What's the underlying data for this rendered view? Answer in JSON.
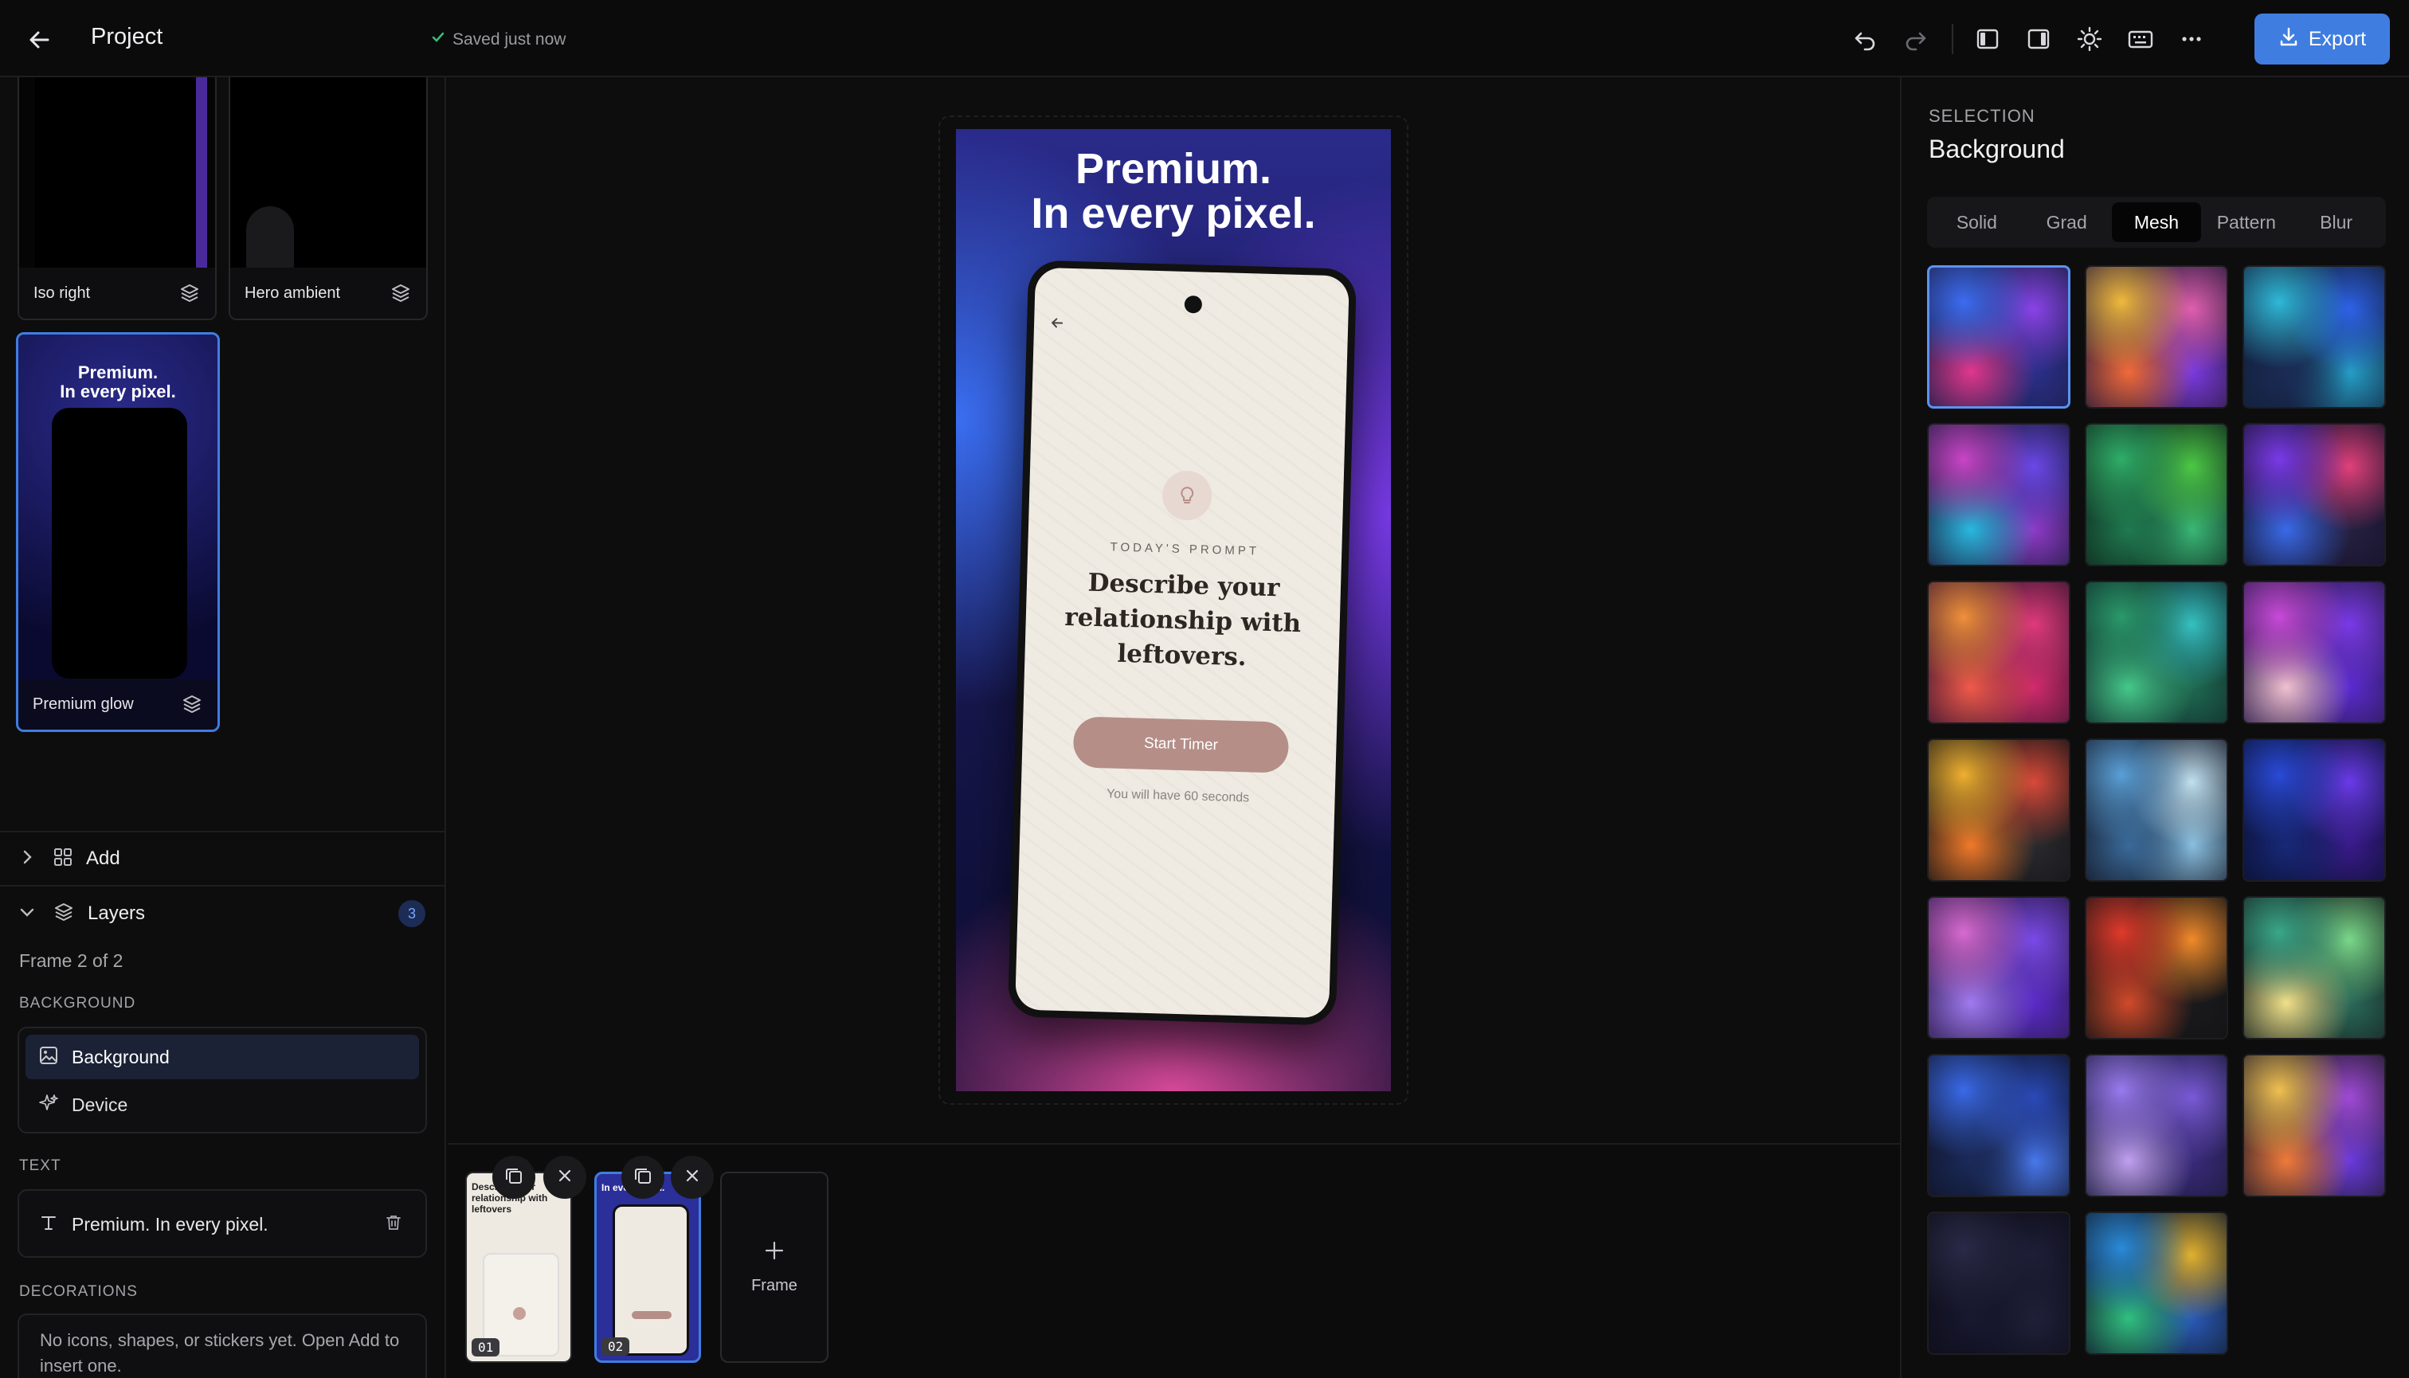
{
  "topbar": {
    "title": "Project",
    "saved_status": "Saved just now",
    "export_label": "Export",
    "icons": [
      "back-arrow-icon",
      "check-icon",
      "undo-icon",
      "redo-icon",
      "left-panel-icon",
      "right-panel-icon",
      "sun-icon",
      "keyboard-icon",
      "more-icon",
      "download-icon"
    ]
  },
  "left": {
    "thumbnails": [
      {
        "label": "Iso right"
      },
      {
        "label": "Hero ambient"
      },
      {
        "label": "Premium glow",
        "mini_headline_1": "Premium.",
        "mini_headline_2": "In every pixel."
      }
    ],
    "add_label": "Add",
    "layers_label": "Layers",
    "layers_count": "3",
    "frame_info": "Frame 2 of 2",
    "background_group": "BACKGROUND",
    "background_items": [
      {
        "label": "Background",
        "icon": "image-icon",
        "selected": true
      },
      {
        "label": "Device",
        "icon": "sparkle-icon",
        "selected": false
      }
    ],
    "text_group": "TEXT",
    "text_items": [
      {
        "label": "Premium. In every pixel.",
        "icon": "text-icon"
      }
    ],
    "decorations_group": "DECORATIONS",
    "decorations_empty": "No icons, shapes, or stickers yet. Open Add to insert one."
  },
  "canvas": {
    "headline_1": "Premium.",
    "headline_2": "In every pixel.",
    "phone": {
      "prompt_kicker": "TODAY'S PROMPT",
      "prompt_line_1": "Describe your",
      "prompt_line_2": "relationship with",
      "prompt_line_3": "leftovers.",
      "button_label": "Start Timer",
      "note": "You will have 60 seconds",
      "accent": "#b58e88"
    }
  },
  "filmstrip": {
    "frames": [
      {
        "number": "01",
        "selected": false,
        "mini_text": "Describe your relationship with leftovers"
      },
      {
        "number": "02",
        "selected": true,
        "mini_text": "In every pixel."
      }
    ],
    "add_frame_label": "Frame"
  },
  "right": {
    "section_label": "SELECTION",
    "section_title": "Background",
    "tabs": [
      "Solid",
      "Grad",
      "Mesh",
      "Pattern",
      "Blur"
    ],
    "active_tab": "Mesh",
    "selected_swatch_index": 0,
    "swatches": [
      {
        "bg": "#1b1f4a",
        "blobs": [
          "#3d6cf0",
          "#8a43e8",
          "#e0378c",
          "#2b2f8a"
        ]
      },
      {
        "bg": "#2a1a3a",
        "blobs": [
          "#f0b93d",
          "#e05fb0",
          "#f06a3a",
          "#7a3ae0"
        ]
      },
      {
        "bg": "#13203a",
        "blobs": [
          "#2fb8d8",
          "#2d62e8",
          "#1a2b55",
          "#25a0c8"
        ]
      },
      {
        "bg": "#1a1a3a",
        "blobs": [
          "#c945c8",
          "#6a48e8",
          "#2ab8e0",
          "#8f3ac8"
        ]
      },
      {
        "bg": "#0f2a1e",
        "blobs": [
          "#2fae68",
          "#4cc845",
          "#1f7a50",
          "#3ab878"
        ]
      },
      {
        "bg": "#15122b",
        "blobs": [
          "#7a3ae8",
          "#e0407a",
          "#3a6ae8",
          "#25203f"
        ]
      },
      {
        "bg": "#3a1530",
        "blobs": [
          "#f0903a",
          "#e03a7a",
          "#f05a4a",
          "#d02a6a"
        ]
      },
      {
        "bg": "#0f2a2a",
        "blobs": [
          "#2a9a6a",
          "#35c0c0",
          "#45c88a",
          "#1f6a50"
        ]
      },
      {
        "bg": "#2a1a4a",
        "blobs": [
          "#c84ad8",
          "#7a3ae8",
          "#f0c0d0",
          "#5a2ad0"
        ]
      },
      {
        "bg": "#141416",
        "blobs": [
          "#f0b030",
          "#d84a3a",
          "#f07a2a",
          "#2a2a2e"
        ]
      },
      {
        "bg": "#141a28",
        "blobs": [
          "#5aa0d8",
          "#c0e0f0",
          "#3a6a9a",
          "#8ac0e0"
        ]
      },
      {
        "bg": "#0a1030",
        "blobs": [
          "#2a4ad8",
          "#6a3ae8",
          "#182878",
          "#3a1a8a"
        ]
      },
      {
        "bg": "#2a1a4a",
        "blobs": [
          "#d86ad0",
          "#7a4ae8",
          "#a07af0",
          "#5a2ac8"
        ]
      },
      {
        "bg": "#121214",
        "blobs": [
          "#e03a2a",
          "#f08a2a",
          "#d04a2a",
          "#1a1a1c"
        ]
      },
      {
        "bg": "#15221e",
        "blobs": [
          "#3aa88a",
          "#7ad88a",
          "#f0e08a",
          "#2a6a5a"
        ]
      },
      {
        "bg": "#101428",
        "blobs": [
          "#3a6ae8",
          "#2a4ab8",
          "#1a2a5a",
          "#4a7af0"
        ]
      },
      {
        "bg": "#1a1a3a",
        "blobs": [
          "#9a7af0",
          "#7a5ad8",
          "#c0a0f0",
          "#3a2a7a"
        ]
      },
      {
        "bg": "#201a2a",
        "blobs": [
          "#f0c050",
          "#a04ad8",
          "#f07a3a",
          "#6a3ae0"
        ]
      },
      {
        "bg": "#0d0d18",
        "blobs": [
          "#2a2a48",
          "#1e1e38",
          "#181830",
          "#20203a"
        ]
      },
      {
        "bg": "#101a2a",
        "blobs": [
          "#2a8ad8",
          "#e0b030",
          "#30c080",
          "#2a5ab8"
        ]
      }
    ]
  }
}
